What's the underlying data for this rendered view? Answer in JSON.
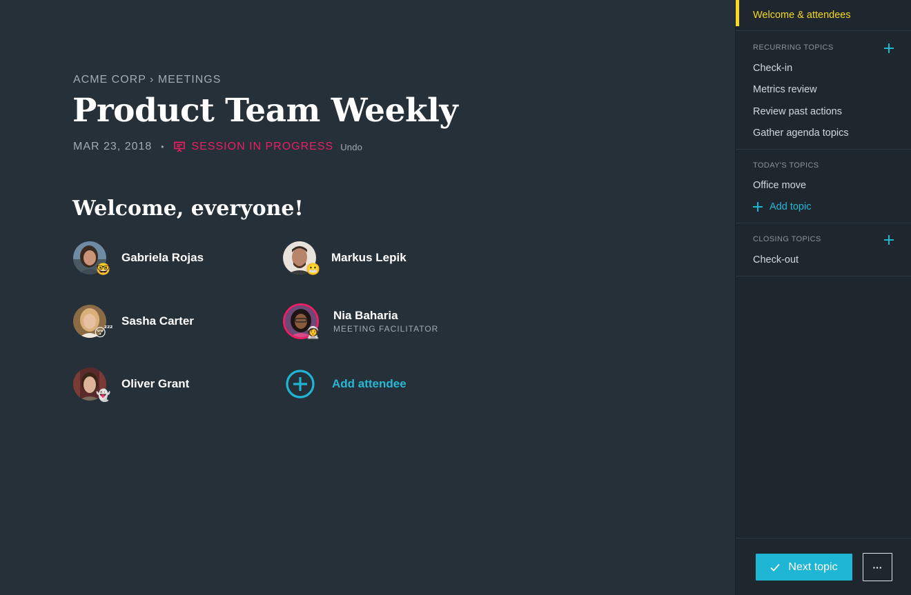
{
  "header": {
    "breadcrumb": "ACME CORP › MEETINGS",
    "title": "Product Team Weekly",
    "date": "MAR 23, 2018",
    "separator": "•",
    "status": "SESSION IN PROGRESS",
    "undo_label": "Undo"
  },
  "welcome": {
    "heading": "Welcome, everyone!",
    "attendees": [
      {
        "name": "Gabriela Rojas",
        "mood": "🤓",
        "role": ""
      },
      {
        "name": "Markus Lepik",
        "mood": "😬",
        "role": ""
      },
      {
        "name": "Sasha Carter",
        "mood": "😴",
        "role": ""
      },
      {
        "name": "Nia Baharia",
        "mood": "👩‍🚀",
        "role": "MEETING FACILITATOR"
      },
      {
        "name": "Oliver Grant",
        "mood": "👻",
        "role": ""
      }
    ],
    "add_attendee_label": "Add attendee"
  },
  "sidebar": {
    "active_item": "Welcome & attendees",
    "recurring": {
      "heading": "RECURRING TOPICS",
      "items": [
        "Check-in",
        "Metrics review",
        "Review past actions",
        "Gather agenda topics"
      ]
    },
    "today": {
      "heading": "TODAY'S TOPICS",
      "items": [
        "Office move"
      ],
      "add_label": "Add topic"
    },
    "closing": {
      "heading": "CLOSING TOPICS",
      "items": [
        "Check-out"
      ]
    },
    "next_label": "Next topic",
    "more_label": "···"
  },
  "colors": {
    "background": "#263038",
    "sidebar": "#1f272e",
    "accent": "#1fb5d4",
    "active": "#f7d925",
    "status": "#ed1f64"
  }
}
